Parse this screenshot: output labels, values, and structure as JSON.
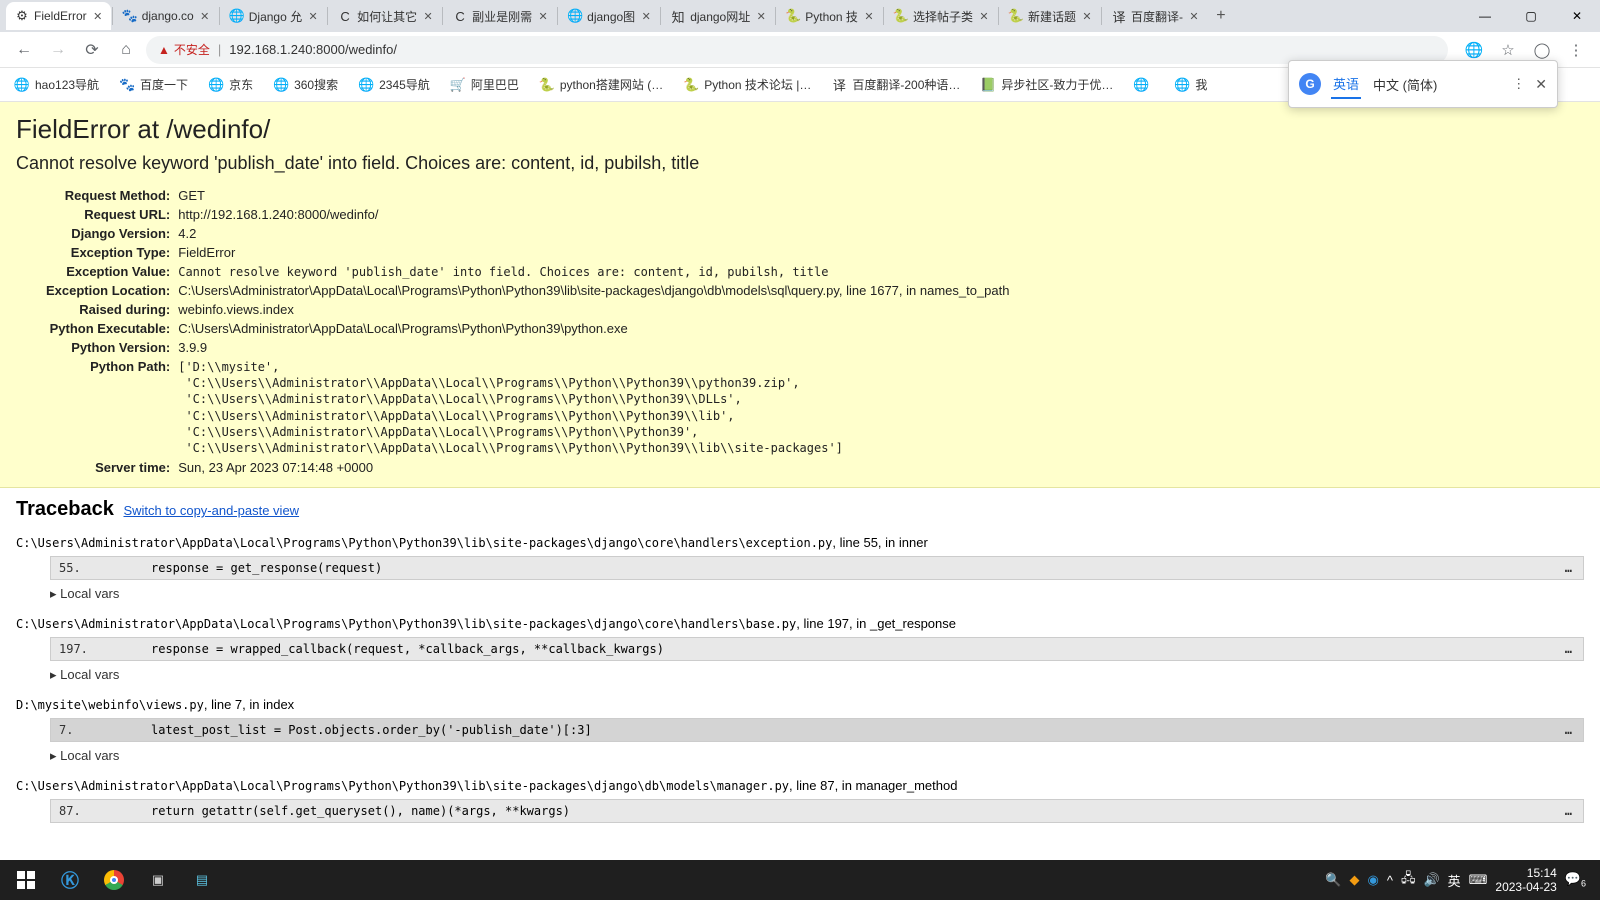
{
  "browser": {
    "tabs": [
      {
        "title": "FieldError",
        "favicon": "⚙"
      },
      {
        "title": "django.co",
        "favicon": "🐾"
      },
      {
        "title": "Django 允",
        "favicon": "🌐"
      },
      {
        "title": "如何让其它",
        "favicon": "C"
      },
      {
        "title": "副业是刚需",
        "favicon": "C"
      },
      {
        "title": "django图",
        "favicon": "🌐"
      },
      {
        "title": "django网址",
        "favicon": "知"
      },
      {
        "title": "Python 技",
        "favicon": "🐍"
      },
      {
        "title": "选择帖子类",
        "favicon": "🐍"
      },
      {
        "title": "新建话题",
        "favicon": "🐍"
      },
      {
        "title": "百度翻译-",
        "favicon": "译"
      }
    ],
    "active_tab": 0,
    "address": {
      "warn_label": "不安全",
      "url": "192.168.1.240:8000/wedinfo/"
    },
    "bookmarks": [
      {
        "icon": "🌐",
        "label": "hao123导航"
      },
      {
        "icon": "🐾",
        "label": "百度一下"
      },
      {
        "icon": "🌐",
        "label": "京东"
      },
      {
        "icon": "🌐",
        "label": "360搜索"
      },
      {
        "icon": "🌐",
        "label": "2345导航"
      },
      {
        "icon": "🛒",
        "label": "阿里巴巴"
      },
      {
        "icon": "🐍",
        "label": "python搭建网站 (…"
      },
      {
        "icon": "🐍",
        "label": "Python 技术论坛 |…"
      },
      {
        "icon": "译",
        "label": "百度翻译-200种语…"
      },
      {
        "icon": "📗",
        "label": "异步社区-致力于优…"
      },
      {
        "icon": "🌐",
        "label": ""
      },
      {
        "icon": "🌐",
        "label": "我"
      }
    ],
    "translate": {
      "lang1": "英语",
      "lang2": "中文 (简体)"
    }
  },
  "error": {
    "title": "FieldError at /wedinfo/",
    "subtitle": "Cannot resolve keyword 'publish_date' into field. Choices are: content, id, pubilsh, title",
    "meta": {
      "Request Method": "GET",
      "Request URL": "http://192.168.1.240:8000/wedinfo/",
      "Django Version": "4.2",
      "Exception Type": "FieldError",
      "Exception Value": "Cannot resolve keyword 'publish_date' into field. Choices are: content, id, pubilsh, title",
      "Exception Location": "C:\\Users\\Administrator\\AppData\\Local\\Programs\\Python\\Python39\\lib\\site-packages\\django\\db\\models\\sql\\query.py, line 1677, in names_to_path",
      "Raised during": "webinfo.views.index",
      "Python Executable": "C:\\Users\\Administrator\\AppData\\Local\\Programs\\Python\\Python39\\python.exe",
      "Python Version": "3.9.9",
      "Python Path": "['D:\\\\mysite',\n 'C:\\\\Users\\\\Administrator\\\\AppData\\\\Local\\\\Programs\\\\Python\\\\Python39\\\\python39.zip',\n 'C:\\\\Users\\\\Administrator\\\\AppData\\\\Local\\\\Programs\\\\Python\\\\Python39\\\\DLLs',\n 'C:\\\\Users\\\\Administrator\\\\AppData\\\\Local\\\\Programs\\\\Python\\\\Python39\\\\lib',\n 'C:\\\\Users\\\\Administrator\\\\AppData\\\\Local\\\\Programs\\\\Python\\\\Python39',\n 'C:\\\\Users\\\\Administrator\\\\AppData\\\\Local\\\\Programs\\\\Python\\\\Python39\\\\lib\\\\site-packages']",
      "Server time": "Sun, 23 Apr 2023 07:14:48 +0000"
    },
    "traceback_heading": "Traceback",
    "switch_link": "Switch to copy-and-paste view",
    "local_vars_label": "Local vars",
    "frames": [
      {
        "path": "C:\\Users\\Administrator\\AppData\\Local\\Programs\\Python\\Python39\\lib\\site-packages\\django\\core\\handlers\\exception.py",
        "where": ", line 55, in inner",
        "line_no": "55.",
        "code": "        response = get_response(request)",
        "light": true
      },
      {
        "path": "C:\\Users\\Administrator\\AppData\\Local\\Programs\\Python\\Python39\\lib\\site-packages\\django\\core\\handlers\\base.py",
        "where": ", line 197, in _get_response",
        "line_no": "197.",
        "code": "        response = wrapped_callback(request, *callback_args, **callback_kwargs)",
        "light": true
      },
      {
        "path": "D:\\mysite\\webinfo\\views.py",
        "where": ", line 7, in index",
        "line_no": "7.",
        "code": "    latest_post_list = Post.objects.order_by('-publish_date')[:3]",
        "light": false
      },
      {
        "path": "C:\\Users\\Administrator\\AppData\\Local\\Programs\\Python\\Python39\\lib\\site-packages\\django\\db\\models\\manager.py",
        "where": ", line 87, in manager_method",
        "line_no": "87.",
        "code": "        return getattr(self.get_queryset(), name)(*args, **kwargs)",
        "light": true
      }
    ]
  },
  "taskbar": {
    "time": "15:14",
    "date": "2023-04-23",
    "ime": "英",
    "notif": "6"
  }
}
